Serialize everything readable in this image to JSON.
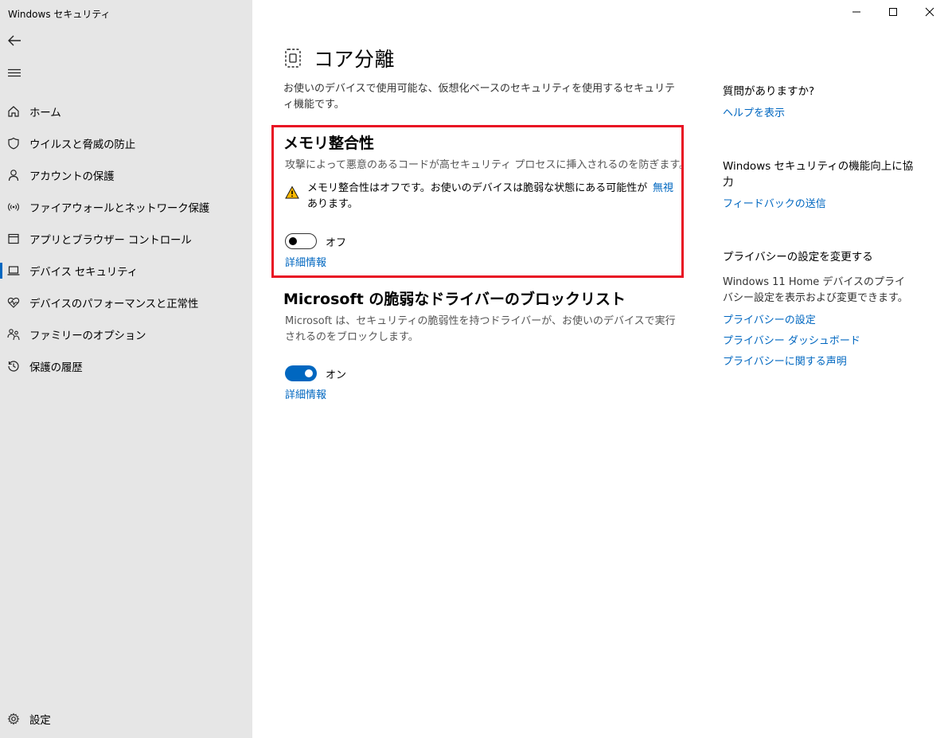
{
  "app": {
    "title": "Windows セキュリティ"
  },
  "sidebar": {
    "items": [
      {
        "label": "ホーム",
        "icon": "home-icon"
      },
      {
        "label": "ウイルスと脅威の防止",
        "icon": "shield-icon"
      },
      {
        "label": "アカウントの保護",
        "icon": "person-icon"
      },
      {
        "label": "ファイアウォールとネットワーク保護",
        "icon": "wifi-antenna-icon"
      },
      {
        "label": "アプリとブラウザー コントロール",
        "icon": "app-window-icon"
      },
      {
        "label": "デバイス セキュリティ",
        "icon": "laptop-icon",
        "active": true
      },
      {
        "label": "デバイスのパフォーマンスと正常性",
        "icon": "heart-pulse-icon"
      },
      {
        "label": "ファミリーのオプション",
        "icon": "family-icon"
      },
      {
        "label": "保護の履歴",
        "icon": "history-icon"
      }
    ],
    "settings_label": "設定"
  },
  "main": {
    "title": "コア分離",
    "description": "お使いのデバイスで使用可能な、仮想化ベースのセキュリティを使用するセキュリティ機能です。",
    "memory_integrity": {
      "title": "メモリ整合性",
      "description": "攻撃によって悪意のあるコードが高セキュリティ プロセスに挿入されるのを防ぎます。",
      "warning": "メモリ整合性はオフです。お使いのデバイスは脆弱な状態にある可能性があります。",
      "dismiss": "無視",
      "toggle_state": "off",
      "toggle_label": "オフ",
      "details_link": "詳細情報"
    },
    "driver_blocklist": {
      "title": "Microsoft の脆弱なドライバーのブロックリスト",
      "description": "Microsoft は、セキュリティの脆弱性を持つドライバーが、お使いのデバイスで実行されるのをブロックします。",
      "toggle_state": "on",
      "toggle_label": "オン",
      "details_link": "詳細情報"
    }
  },
  "rail": {
    "help_heading": "質問がありますか?",
    "help_link": "ヘルプを表示",
    "feedback_heading": "Windows セキュリティの機能向上に協力",
    "feedback_link": "フィードバックの送信",
    "privacy_heading": "プライバシーの設定を変更する",
    "privacy_text": "Windows 11 Home デバイスのプライバシー設定を表示および変更できます。",
    "privacy_links": [
      "プライバシーの設定",
      "プライバシー ダッシュボード",
      "プライバシーに関する声明"
    ]
  },
  "colors": {
    "accent": "#0067c0",
    "highlight": "#e81123",
    "warning": "#ffb900",
    "sidebar": "#e6e6e6"
  }
}
